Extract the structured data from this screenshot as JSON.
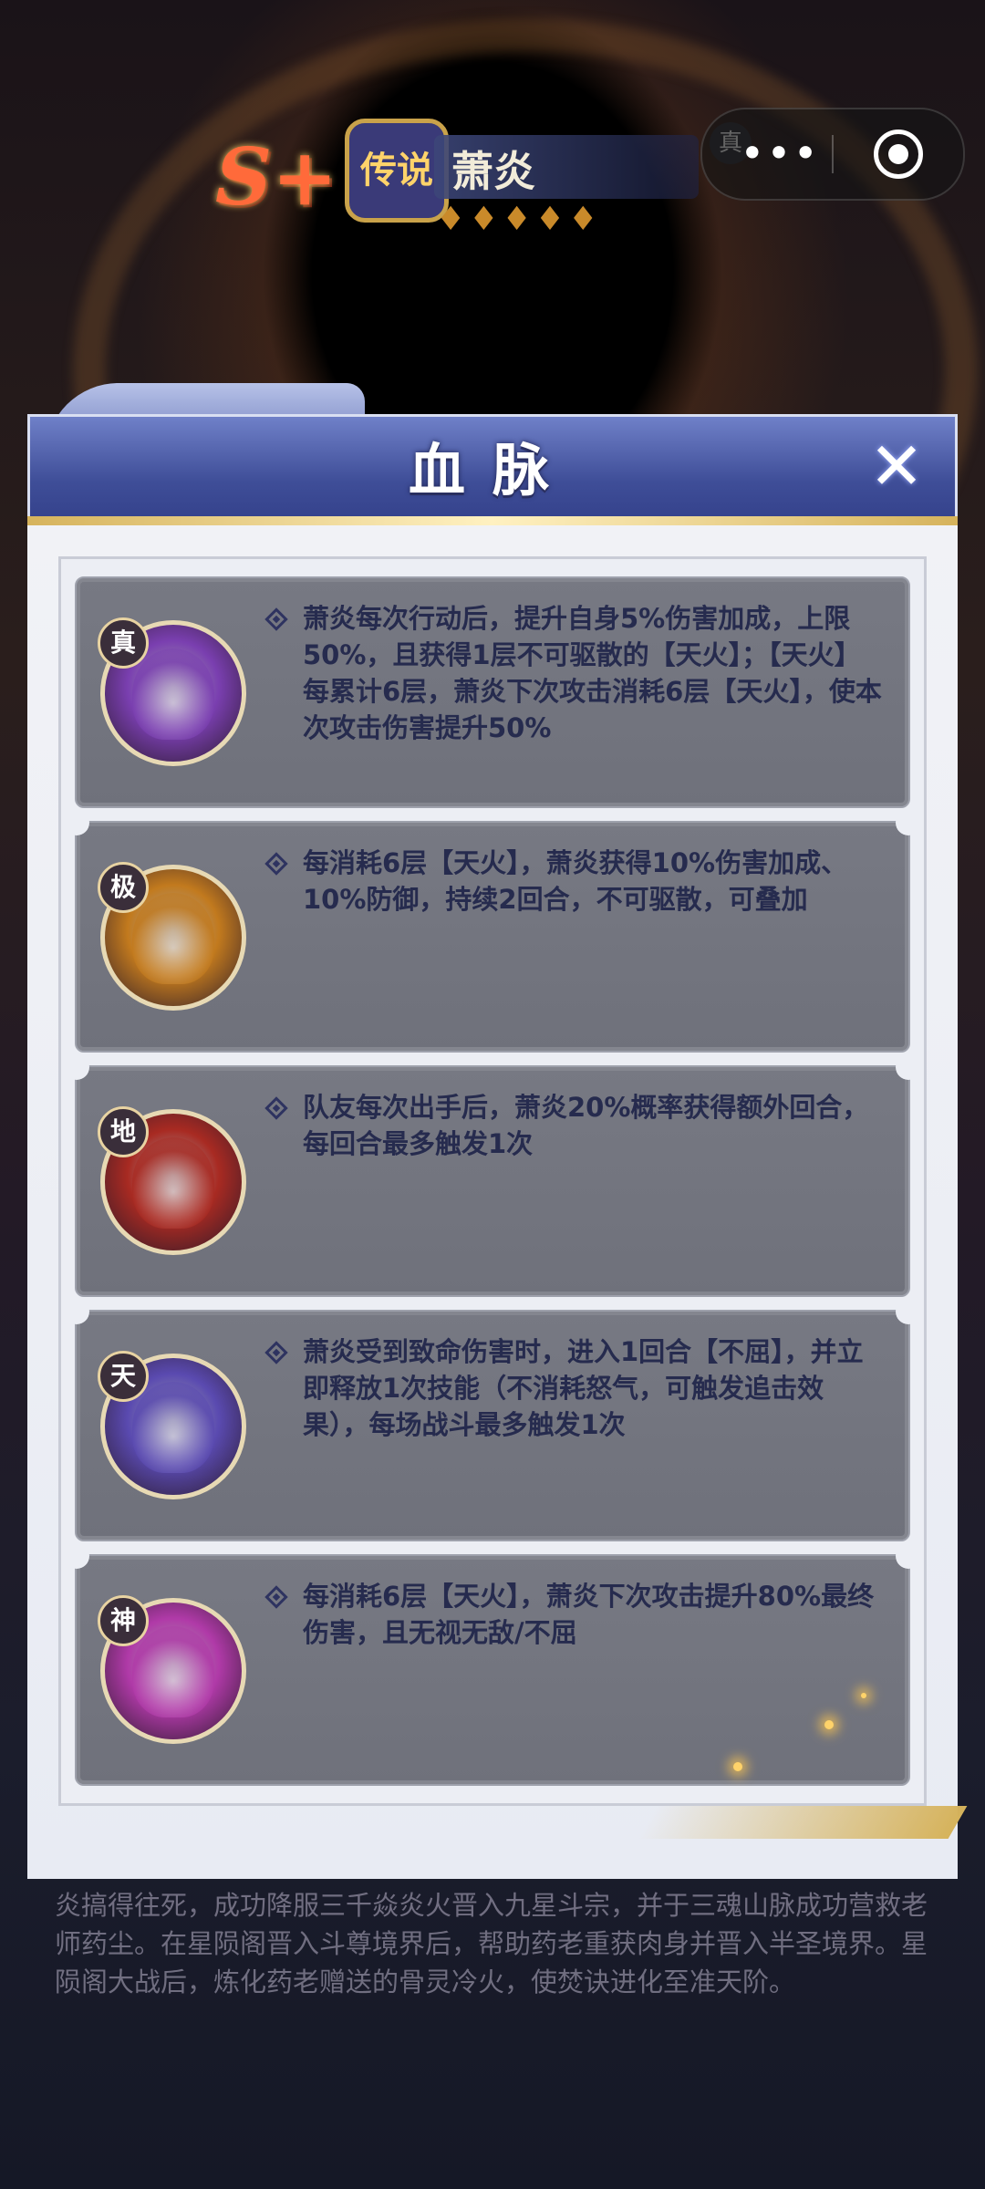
{
  "header": {
    "rank": "S+",
    "rarity": "传说",
    "hero_name": "萧炎",
    "stars": "♦♦♦♦♦",
    "tag": "真",
    "more_icon": "•••",
    "target_icon": "target-icon"
  },
  "dialog": {
    "title": "血脉",
    "close_label": "✕",
    "items": [
      {
        "tier": "真",
        "text": "萧炎每次行动后，提升自身5%伤害加成，上限50%，且获得1层不可驱散的【天火】；【天火】每累计6层，萧炎下次攻击消耗6层【天火】，使本次攻击伤害提升50%",
        "color": "#7a3fb0"
      },
      {
        "tier": "极",
        "text": "每消耗6层【天火】，萧炎获得10%伤害加成、10%防御，持续2回合，不可驱散，可叠加",
        "color": "#c27a1e"
      },
      {
        "tier": "地",
        "text": "队友每次出手后，萧炎20%概率获得额外回合，每回合最多触发1次",
        "color": "#a82a22"
      },
      {
        "tier": "天",
        "text": "萧炎受到致命伤害时，进入1回合【不屈】，并立即释放1次技能（不消耗怒气，可触发追击效果），每场战斗最多触发1次",
        "color": "#5a4ab0"
      },
      {
        "tier": "神",
        "text": "每消耗6层【天火】，萧炎下次攻击提升80%最终伤害，且无视无敌/不屈",
        "color": "#b03aa8"
      }
    ]
  },
  "background_text": "炎搞得往死，成功降服三千焱炎火晋入九星斗宗，并于三魂山脉成功营救老师药尘。在星陨阁晋入斗尊境界后，帮助药老重获肉身并晋入半圣境界。星陨阁大战后，炼化药老赠送的骨灵冷火，使焚诀进化至准天阶。"
}
